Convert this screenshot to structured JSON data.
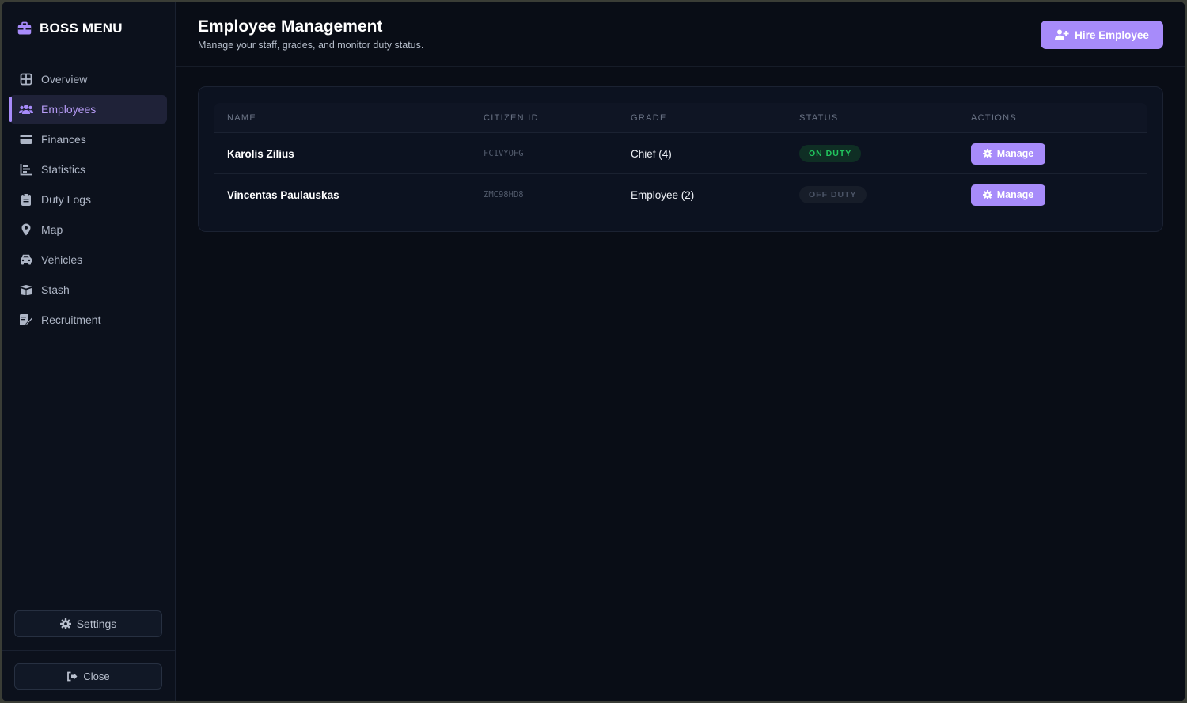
{
  "sidebar": {
    "brand": {
      "title": "BOSS MENU",
      "icon": "briefcase-icon"
    },
    "items": [
      {
        "label": "Overview",
        "icon": "grid-icon",
        "active": false
      },
      {
        "label": "Employees",
        "icon": "users-icon",
        "active": true
      },
      {
        "label": "Finances",
        "icon": "wallet-icon",
        "active": false
      },
      {
        "label": "Statistics",
        "icon": "chart-icon",
        "active": false
      },
      {
        "label": "Duty Logs",
        "icon": "clipboard-icon",
        "active": false
      },
      {
        "label": "Map",
        "icon": "map-pin-icon",
        "active": false
      },
      {
        "label": "Vehicles",
        "icon": "car-icon",
        "active": false
      },
      {
        "label": "Stash",
        "icon": "box-icon",
        "active": false
      },
      {
        "label": "Recruitment",
        "icon": "signature-icon",
        "active": false
      }
    ],
    "settings_label": "Settings",
    "close_label": "Close"
  },
  "header": {
    "title": "Employee Management",
    "subtitle": "Manage your staff, grades, and monitor duty status.",
    "hire_label": "Hire Employee"
  },
  "table": {
    "columns": [
      "NAME",
      "CITIZEN ID",
      "GRADE",
      "STATUS",
      "ACTIONS"
    ],
    "rows": [
      {
        "name": "Karolis Zilius",
        "citizen_id": "FC1VYOFG",
        "grade": "Chief (4)",
        "status": "ON DUTY",
        "action": "Manage"
      },
      {
        "name": "Vincentas Paulauskas",
        "citizen_id": "ZMC98HD8",
        "grade": "Employee (2)",
        "status": "OFF DUTY",
        "action": "Manage"
      }
    ]
  },
  "colors": {
    "accent": "#a78bfa",
    "background": "#090d16",
    "on_duty": "#22c55e",
    "off_duty": "#4b5466"
  }
}
